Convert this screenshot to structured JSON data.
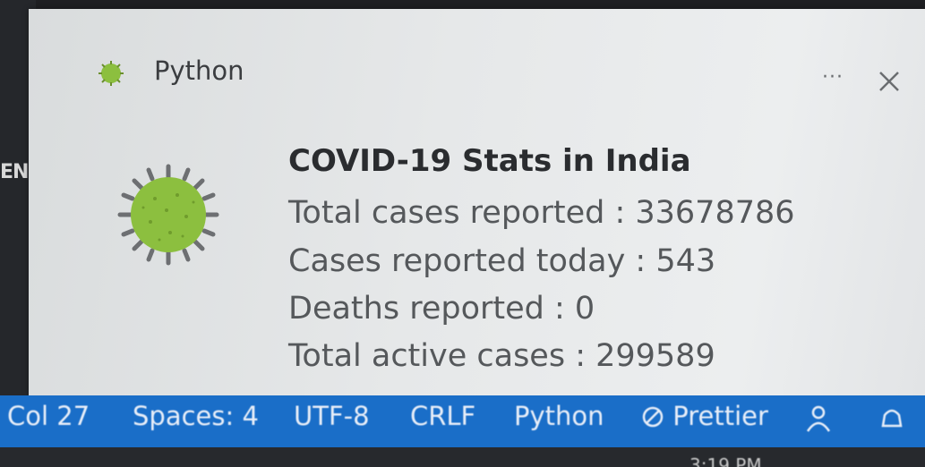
{
  "editor": {
    "edge_text": "EN"
  },
  "toast": {
    "app_name": "Python",
    "more_label": "···",
    "title": "COVID-19 Stats in India",
    "lines": [
      "Total cases reported : 33678786",
      "Cases reported today : 543",
      "Deaths reported : 0",
      "Total active cases : 299589"
    ]
  },
  "status_bar": {
    "col": "Col 27",
    "spaces": "Spaces: 4",
    "encoding": "UTF-8",
    "eol": "CRLF",
    "language": "Python",
    "prettier": "Prettier"
  },
  "taskbar": {
    "clock": "3:19 PM"
  },
  "colors": {
    "status_bar": "#1a6ec8",
    "virus_green": "#8cbf3f",
    "toast_bg": "#e6e8e9"
  }
}
